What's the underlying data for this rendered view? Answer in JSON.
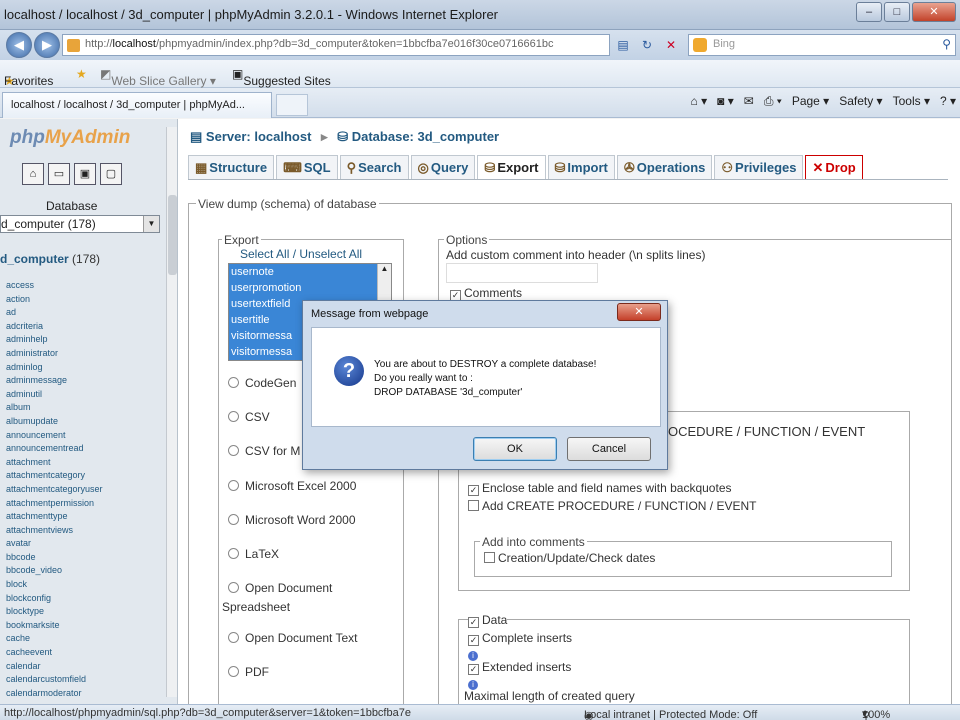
{
  "window": {
    "title": "localhost / localhost / 3d_computer | phpMyAdmin 3.2.0.1 - Windows Internet Explorer",
    "min": "–",
    "max": "□",
    "close": "✕"
  },
  "address": {
    "url_prefix": "http://",
    "url_host": "localhost",
    "url_rest": "/phpmyadmin/index.php?db=3d_computer&token=1bbcfba7e016f30ce0716661bc",
    "search_placeholder": "Bing"
  },
  "favorites": {
    "label": "Favorites",
    "web_slice": "Web Slice Gallery ▾",
    "suggested": "Suggested Sites"
  },
  "tab": {
    "label": "localhost / localhost / 3d_computer | phpMyAd..."
  },
  "commandbar": {
    "page": "Page ▾",
    "safety": "Safety ▾",
    "tools": "Tools ▾",
    "help": "? ▾"
  },
  "left": {
    "logo_php": "php",
    "logo_myadmin": "MyAdmin",
    "database_label": "Database",
    "db_select_value": "d_computer (178)",
    "db_name": "d_computer",
    "db_count": "(178)",
    "tables": [
      "access",
      "action",
      "ad",
      "adcriteria",
      "adminhelp",
      "administrator",
      "adminlog",
      "adminmessage",
      "adminutil",
      "album",
      "albumupdate",
      "announcement",
      "announcementread",
      "attachment",
      "attachmentcategory",
      "attachmentcategoryuser",
      "attachmentpermission",
      "attachmenttype",
      "attachmentviews",
      "avatar",
      "bbcode",
      "bbcode_video",
      "block",
      "blockconfig",
      "blocktype",
      "bookmarksite",
      "cache",
      "cacheevent",
      "calendar",
      "calendarcustomfield",
      "calendarmoderator"
    ]
  },
  "breadcrumb": {
    "server": "Server: localhost",
    "database": "Database: 3d_computer"
  },
  "tabs": {
    "structure": "Structure",
    "sql": "SQL",
    "search": "Search",
    "query": "Query",
    "export": "Export",
    "import": "Import",
    "operations": "Operations",
    "privileges": "Privileges",
    "drop": "Drop"
  },
  "dump": {
    "legend": "View dump (schema) of database",
    "export_legend": "Export",
    "select_all": "Select All",
    "slash": " / ",
    "unselect_all": "Unselect All",
    "selected_tables": [
      "usernote",
      "userpromotion",
      "usertextfield",
      "usertitle",
      "visitormessa",
      "visitormessa"
    ],
    "formats": [
      "CodeGen",
      "CSV",
      "CSV for M",
      "Microsoft Excel 2000",
      "Microsoft Word 2000",
      "LaTeX",
      "Open Document",
      "Open Document Text",
      "PDF"
    ],
    "odf_spreadsheet": "Spreadsheet",
    "options_legend": "Options",
    "add_comment": "Add custom comment into header (\\n splits lines)",
    "comments": "Comments",
    "create_proc_partial": "OCEDURE / FUNCTION / EVENT",
    "enclose": "Enclose table and field names with backquotes",
    "add_create_proc": "Add CREATE PROCEDURE / FUNCTION / EVENT",
    "add_into_comments": "Add into comments",
    "creation_dates": "Creation/Update/Check dates",
    "data": "Data",
    "complete_inserts": "Complete inserts",
    "extended_inserts": "Extended inserts",
    "max_length": "Maximal length of created query"
  },
  "dialog": {
    "title": "Message from webpage",
    "close": "✕",
    "line1": "You are about to DESTROY a complete database!",
    "line2": "Do you really want to :",
    "line3": "DROP DATABASE '3d_computer'",
    "ok": "OK",
    "cancel": "Cancel"
  },
  "status": {
    "url": "http://localhost/phpmyadmin/sql.php?db=3d_computer&server=1&token=1bbcfba7e",
    "zone": "Local intranet | Protected Mode: Off",
    "zoom": "100%"
  }
}
